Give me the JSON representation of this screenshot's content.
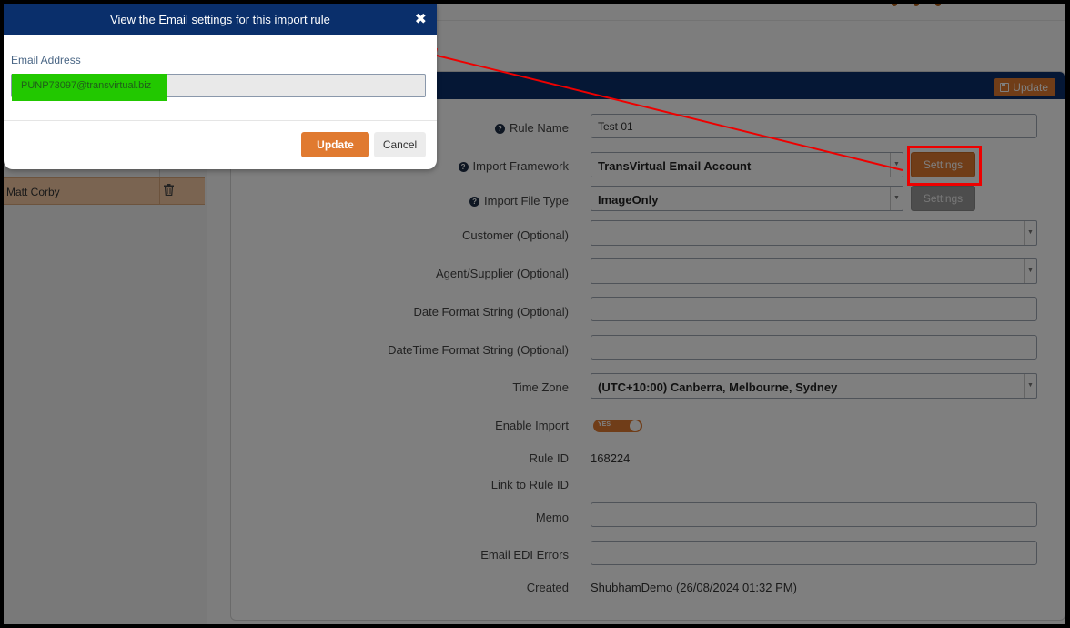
{
  "modal": {
    "title": "View the Email settings for this import rule",
    "close_icon": "×-icon",
    "email_label": "Email Address",
    "email_value": "PUNP73097@transvirtual.biz",
    "update_label": "Update",
    "cancel_label": "Cancel"
  },
  "left_list": {
    "selected_item": "Matt Corby"
  },
  "panel": {
    "update_label": "Update"
  },
  "form": {
    "rule_name_label": "Rule Name",
    "rule_name_value": "Test 01",
    "import_framework_label": "Import Framework",
    "import_framework_value": "TransVirtual Email Account",
    "import_file_type_label": "Import File Type",
    "import_file_type_value": "ImageOnly",
    "settings_label": "Settings",
    "customer_label": "Customer (Optional)",
    "agent_label": "Agent/Supplier (Optional)",
    "date_format_label": "Date Format String (Optional)",
    "datetime_format_label": "DateTime Format String (Optional)",
    "time_zone_label": "Time Zone",
    "time_zone_value": "(UTC+10:00) Canberra, Melbourne, Sydney",
    "enable_import_label": "Enable Import",
    "enable_import_toggle": "YES",
    "rule_id_label": "Rule ID",
    "rule_id_value": "168224",
    "link_rule_id_label": "Link to Rule ID",
    "memo_label": "Memo",
    "email_edi_label": "Email EDI Errors",
    "created_label": "Created",
    "created_value": "ShubhamDemo (26/08/2024 01:32 PM)"
  },
  "colors": {
    "header_navy": "#0a2f6b",
    "accent_orange": "#e07a30",
    "annotation_red": "#ee0000",
    "highlight_green": "#22c800"
  }
}
